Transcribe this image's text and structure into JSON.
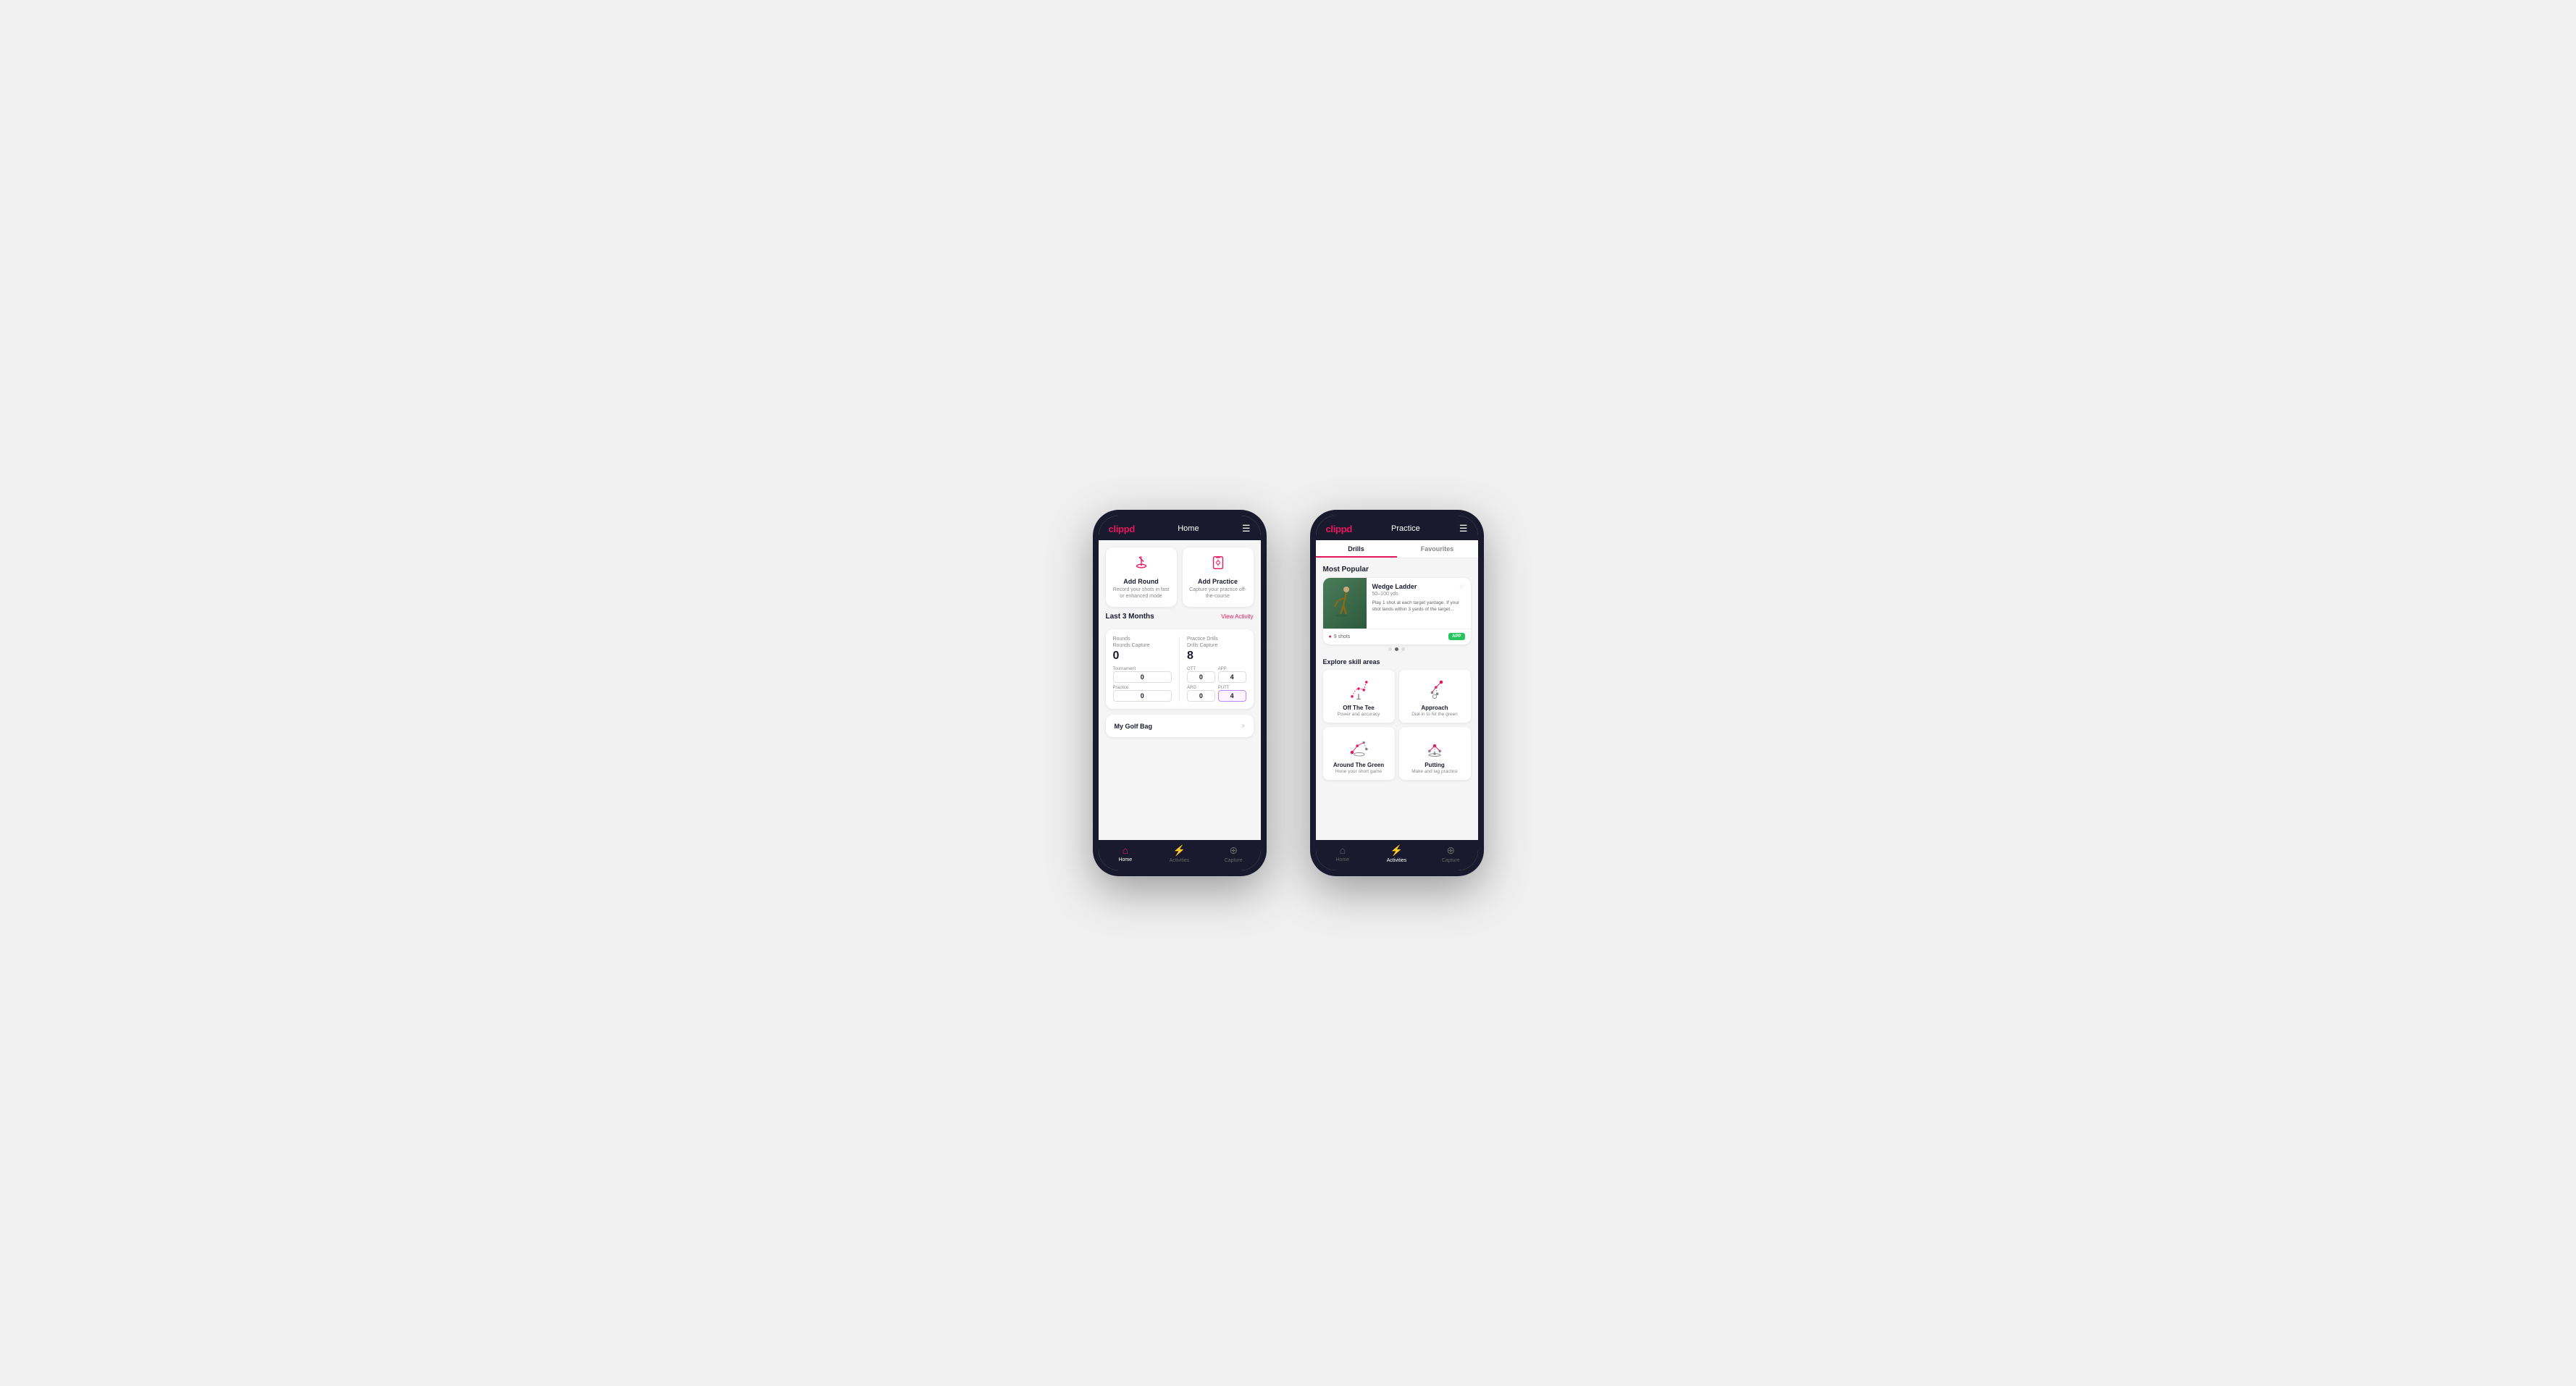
{
  "phone1": {
    "header": {
      "logo": "clippd",
      "title": "Home",
      "menu_icon": "☰"
    },
    "cards": [
      {
        "id": "add-round",
        "icon": "⛳",
        "title": "Add Round",
        "desc": "Record your shots in fast or enhanced mode"
      },
      {
        "id": "add-practice",
        "icon": "📋",
        "title": "Add Practice",
        "desc": "Capture your practice off-the-course"
      }
    ],
    "activity": {
      "title": "Last 3 Months",
      "link": "View Activity"
    },
    "rounds": {
      "title": "Rounds",
      "capture_label": "Rounds Capture",
      "capture_value": "0",
      "tournament_label": "Tournament",
      "tournament_value": "0",
      "practice_label": "Practice",
      "practice_value": "0"
    },
    "drills": {
      "title": "Practice Drills",
      "capture_label": "Drills Capture",
      "capture_value": "8",
      "ott_label": "OTT",
      "ott_value": "0",
      "app_label": "APP",
      "app_value": "4",
      "arg_label": "ARG",
      "arg_value": "0",
      "putt_label": "PUTT",
      "putt_value": "4"
    },
    "golf_bag": {
      "label": "My Golf Bag"
    },
    "nav": [
      {
        "id": "home",
        "icon": "🏠",
        "label": "Home",
        "active": true
      },
      {
        "id": "activities",
        "icon": "⚡",
        "label": "Activities",
        "active": false
      },
      {
        "id": "capture",
        "icon": "➕",
        "label": "Capture",
        "active": false
      }
    ]
  },
  "phone2": {
    "header": {
      "logo": "clippd",
      "title": "Practice",
      "menu_icon": "☰"
    },
    "tabs": [
      {
        "id": "drills",
        "label": "Drills",
        "active": true
      },
      {
        "id": "favourites",
        "label": "Favourites",
        "active": false
      }
    ],
    "most_popular": {
      "title": "Most Popular",
      "drill": {
        "title": "Wedge Ladder",
        "range": "50–100 yds",
        "desc": "Play 1 shot at each target yardage. If your shot lands within 3 yards of the target...",
        "shots": "9 shots",
        "badge": "APP"
      }
    },
    "skill_areas": {
      "title": "Explore skill areas",
      "items": [
        {
          "id": "off-the-tee",
          "name": "Off The Tee",
          "desc": "Power and accuracy",
          "icon_type": "tee"
        },
        {
          "id": "approach",
          "name": "Approach",
          "desc": "Dial-in to hit the green",
          "icon_type": "approach"
        },
        {
          "id": "around-the-green",
          "name": "Around The Green",
          "desc": "Hone your short game",
          "icon_type": "atg"
        },
        {
          "id": "putting",
          "name": "Putting",
          "desc": "Make and lag practice",
          "icon_type": "putting"
        }
      ]
    },
    "nav": [
      {
        "id": "home",
        "icon": "🏠",
        "label": "Home",
        "active": false
      },
      {
        "id": "activities",
        "icon": "⚡",
        "label": "Activities",
        "active": true
      },
      {
        "id": "capture",
        "icon": "➕",
        "label": "Capture",
        "active": false
      }
    ]
  }
}
